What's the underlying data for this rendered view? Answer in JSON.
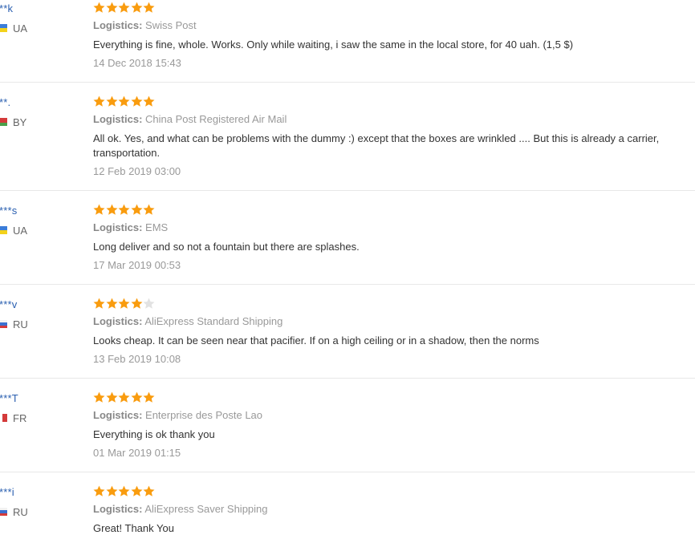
{
  "labels": {
    "logistics": "Logistics:"
  },
  "colors": {
    "star_filled": "#f99c0f",
    "star_empty": "#e2e2e2",
    "username": "#2a5fb0"
  },
  "reviews": [
    {
      "user": "**k",
      "country": "UA",
      "stars": 5,
      "logistics": "Swiss Post",
      "text": "Everything is fine, whole. Works. Only while waiting, i saw the same in the local store, for 40 uah. (1,5 $)",
      "date": "14 Dec 2018 15:43"
    },
    {
      "user": "**.",
      "country": "BY",
      "stars": 5,
      "logistics": "China Post Registered Air Mail",
      "text": "All ok. Yes, and what can be problems with the dummy :) except that the boxes are wrinkled .... But this is already a carrier, transportation.",
      "date": "12 Feb 2019 03:00"
    },
    {
      "user": "***s",
      "country": "UA",
      "stars": 5,
      "logistics": "EMS",
      "text": "Long deliver and so not a fountain but there are splashes.",
      "date": "17 Mar 2019 00:53"
    },
    {
      "user": "***v",
      "country": "RU",
      "stars": 4,
      "logistics": "AliExpress Standard Shipping",
      "text": "Looks cheap. It can be seen near that pacifier. If on a high ceiling or in a shadow, then the norms",
      "date": "13 Feb 2019 10:08"
    },
    {
      "user": "***T",
      "country": "FR",
      "stars": 5,
      "logistics": "Enterprise des Poste Lao",
      "text": "Everything is ok thank you",
      "date": "01 Mar 2019 01:15"
    },
    {
      "user": "***i",
      "country": "RU",
      "stars": 5,
      "logistics": "AliExpress Saver Shipping",
      "text": "Great! Thank You",
      "date": ""
    }
  ]
}
